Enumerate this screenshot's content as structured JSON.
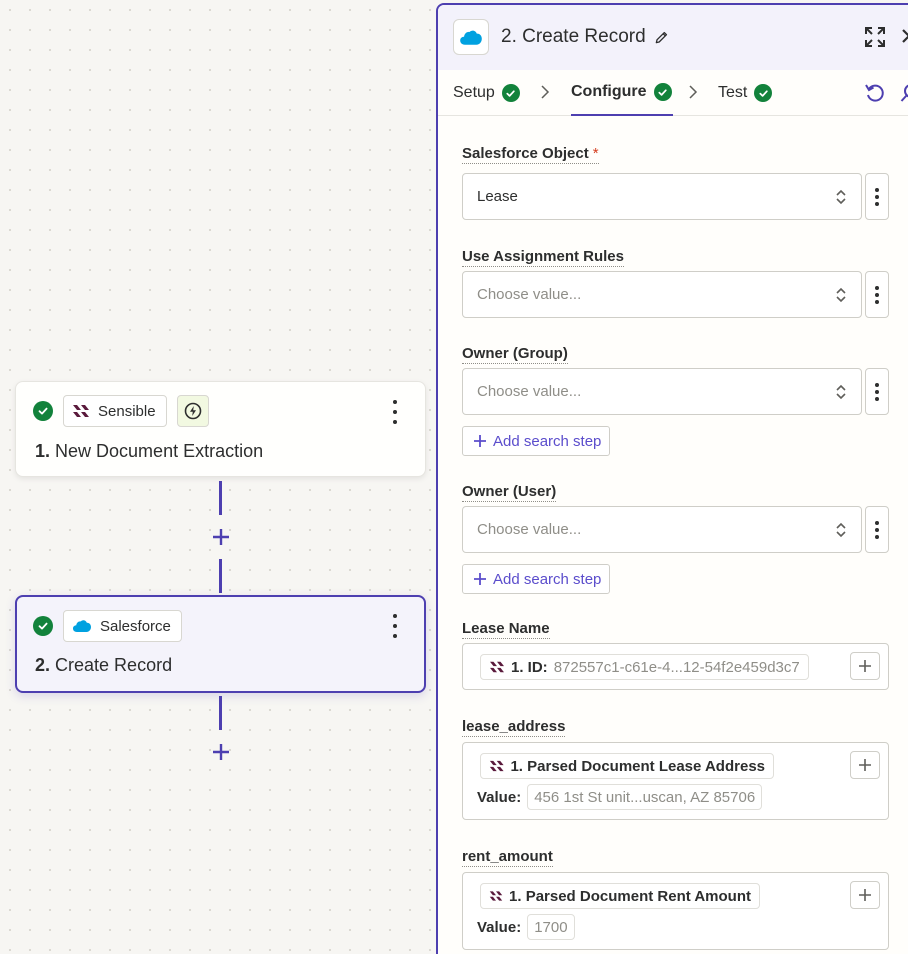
{
  "canvas": {
    "nodes": [
      {
        "app": "Sensible",
        "step_number": "1.",
        "title": "New Document Extraction",
        "has_trigger_badge": true,
        "status": "complete"
      },
      {
        "app": "Salesforce",
        "step_number": "2.",
        "title": "Create Record",
        "selected": true,
        "status": "complete"
      }
    ]
  },
  "panel": {
    "title": "2. Create Record",
    "tabs": [
      {
        "label": "Setup",
        "done": true
      },
      {
        "label": "Configure",
        "done": true,
        "active": true
      },
      {
        "label": "Test",
        "done": true
      }
    ],
    "fields": {
      "salesforce_object": {
        "label": "Salesforce Object",
        "required": "*",
        "value": "Lease"
      },
      "use_assignment_rules": {
        "label": "Use Assignment Rules",
        "placeholder": "Choose value..."
      },
      "owner_group": {
        "label": "Owner (Group)",
        "placeholder": "Choose value...",
        "search_step": "Add search step"
      },
      "owner_user": {
        "label": "Owner (User)",
        "placeholder": "Choose value...",
        "search_step": "Add search step"
      },
      "lease_name": {
        "label": "Lease Name",
        "pill_label": "1. ID:",
        "pill_value": "872557c1-c61e-4...12-54f2e459d3c7"
      },
      "lease_address": {
        "label": "lease_address",
        "pill_label": "1. Parsed Document Lease Address",
        "value_label": "Value:",
        "value": "456 1st St unit...uscan, AZ 85706"
      },
      "rent_amount": {
        "label": "rent_amount",
        "pill_label": "1. Parsed Document Rent Amount",
        "value_label": "Value:",
        "value": "1700"
      }
    }
  },
  "colors": {
    "accent": "#4d3fb0",
    "success": "#12823b",
    "link": "#5b4dcc",
    "salesforce": "#00a1e0",
    "sensible": "#5a1a3c"
  }
}
